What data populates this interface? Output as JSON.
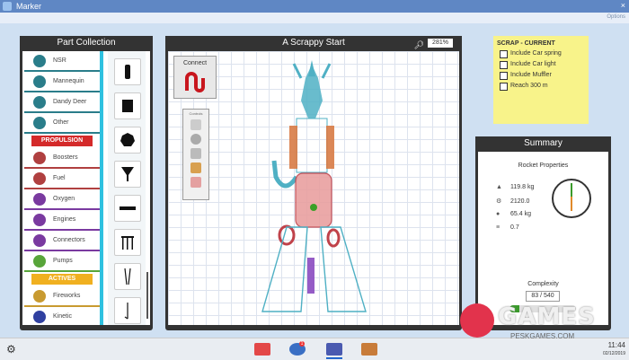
{
  "window": {
    "title": "Marker",
    "close": "×",
    "corner": "Options"
  },
  "part_collection": {
    "title": "Part Collection",
    "rows": [
      {
        "label": "NSR",
        "color": "#2a7d8a"
      },
      {
        "label": "Mannequin",
        "color": "#2a7d8a"
      },
      {
        "label": "Dandy Deer",
        "color": "#2a7d8a"
      },
      {
        "label": "Other",
        "color": "#2a7d8a"
      }
    ],
    "section_propulsion": "PROPULSION",
    "propulsion_rows": [
      {
        "label": "Boosters",
        "color": "#b04040"
      },
      {
        "label": "Fuel",
        "color": "#b04040"
      },
      {
        "label": "Oxygen",
        "color": "#7a3aa0"
      },
      {
        "label": "Engines",
        "color": "#7a3aa0"
      },
      {
        "label": "Connectors",
        "color": "#7a3aa0"
      },
      {
        "label": "Pumps",
        "color": "#58a53a"
      }
    ],
    "section_actives": "ACTIVES",
    "actives_rows": [
      {
        "label": "Fireworks",
        "color": "#c89a30"
      },
      {
        "label": "Kinetic",
        "color": "#3040a0"
      }
    ]
  },
  "scrappy": {
    "title": "A Scrappy Start",
    "zoom": "281%",
    "connect_label": "Connect",
    "controls_label": "Controls"
  },
  "scrap_current": {
    "title": "SCRAP   - CURRENT",
    "items": [
      "Include Car spring",
      "Include Car light",
      "Include Muffler",
      "Reach 300 m"
    ]
  },
  "summary": {
    "title": "Summary",
    "rocket_properties": "Rocket Properties",
    "props": [
      {
        "icon": "▲",
        "value": "119.8 kg"
      },
      {
        "icon": "⚙",
        "value": "2120.0"
      },
      {
        "icon": "●",
        "value": "65.4 kg"
      },
      {
        "icon": "≡",
        "value": "0.7"
      }
    ],
    "complexity_label": "Complexity",
    "complexity_value": "83 / 540",
    "complexity_fraction": 0.154
  },
  "bottom": {
    "clock": "11:44",
    "date": "02/12/2019",
    "badge": "1"
  },
  "watermark": {
    "text": "GAMES",
    "url": "PESKGAMES.COM"
  }
}
